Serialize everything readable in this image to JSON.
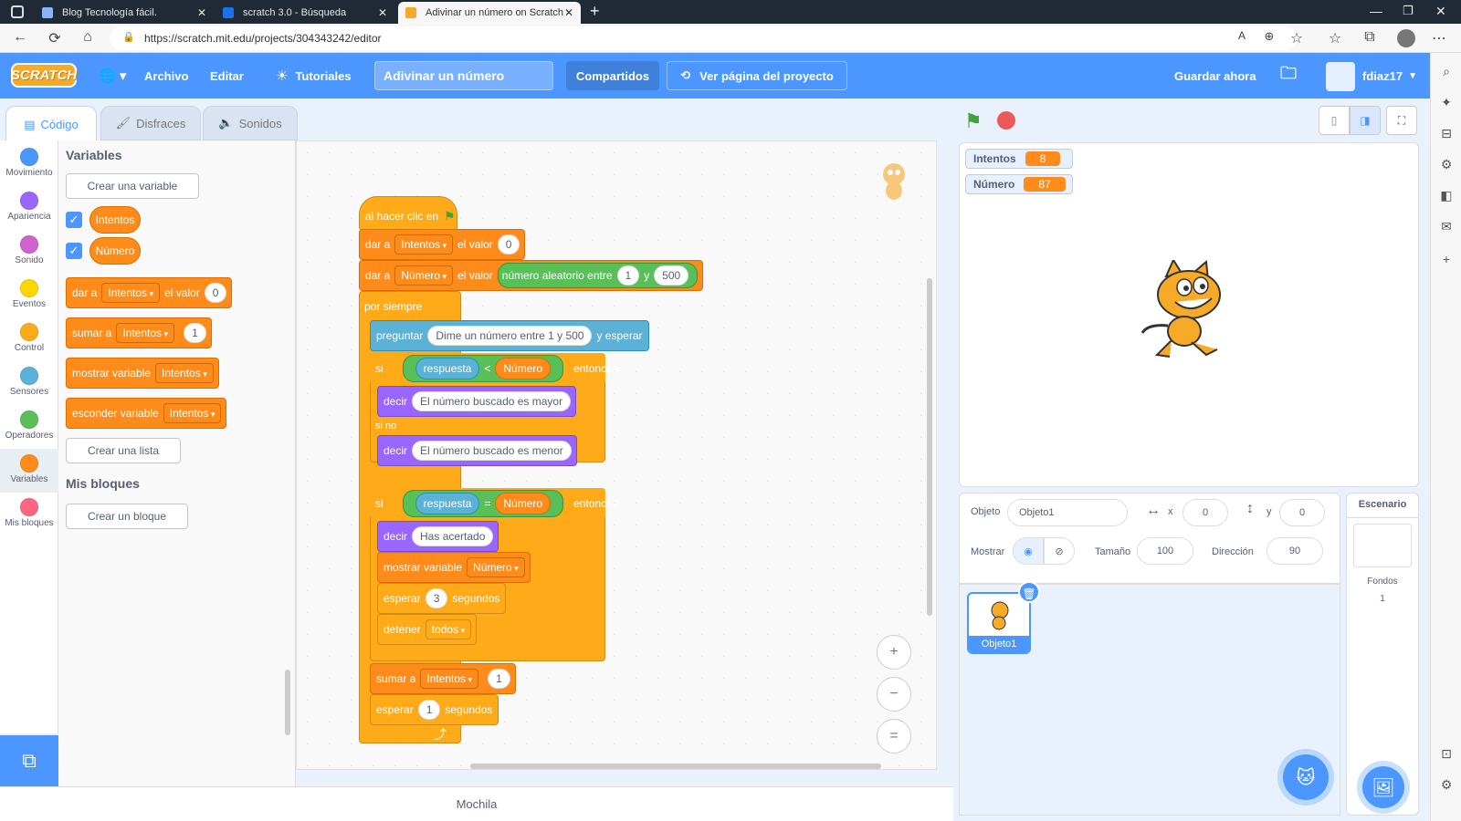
{
  "browser": {
    "tabs": [
      {
        "title": "Blog Tecnología fácil.",
        "favicon_color": "#8ab4f8"
      },
      {
        "title": "scratch 3.0 - Búsqueda",
        "favicon_color": "#1a73e8"
      },
      {
        "title": "Adivinar un número on Scratch",
        "favicon_color": "#f7a928"
      }
    ],
    "new_tab": "+",
    "url": "https://scratch.mit.edu/projects/304343242/editor"
  },
  "menu": {
    "logo": "SCRATCH",
    "globe": "🌐 ▾",
    "file": "Archivo",
    "edit": "Editar",
    "tutorials": "Tutoriales",
    "project_title": "Adivinar un número",
    "share": "Compartidos",
    "see_project": "Ver página del proyecto",
    "save_now": "Guardar ahora",
    "username": "fdiaz17"
  },
  "editor_tabs": {
    "code": "Código",
    "costumes": "Disfraces",
    "sounds": "Sonidos"
  },
  "categories": [
    {
      "label": "Movimiento",
      "color": "#4c97ff"
    },
    {
      "label": "Apariencia",
      "color": "#9966ff"
    },
    {
      "label": "Sonido",
      "color": "#cf63cf"
    },
    {
      "label": "Eventos",
      "color": "#ffd500"
    },
    {
      "label": "Control",
      "color": "#ffab19"
    },
    {
      "label": "Sensores",
      "color": "#5cb1d6"
    },
    {
      "label": "Operadores",
      "color": "#59c059"
    },
    {
      "label": "Variables",
      "color": "#ff8c1a"
    },
    {
      "label": "Mis bloques",
      "color": "#ff6680"
    }
  ],
  "palette": {
    "variables_heading": "Variables",
    "create_variable": "Crear una variable",
    "var1": "Intentos",
    "var2": "Número",
    "set_label": "dar a",
    "set_var": "Intentos",
    "set_value_label": "el valor",
    "set_value": "0",
    "change_label": "sumar a",
    "change_var": "Intentos",
    "change_value": "1",
    "show_label": "mostrar variable",
    "show_var": "Intentos",
    "hide_label": "esconder variable",
    "hide_var": "Intentos",
    "create_list": "Crear una lista",
    "myblocks_heading": "Mis bloques",
    "create_block": "Crear un bloque"
  },
  "script": {
    "hat": "al hacer clic en",
    "set1_label": "dar a",
    "set1_var": "Intentos",
    "set1_value_label": "el valor",
    "set1_value": "0",
    "set2_label": "dar a",
    "set2_var": "Número",
    "set2_value_label": "el valor",
    "random_label": "número aleatorio entre",
    "random_from": "1",
    "random_and": "y",
    "random_to": "500",
    "forever": "por siempre",
    "ask_label": "preguntar",
    "ask_text": "Dime un número entre 1 y 500",
    "ask_wait": "y esperar",
    "if1_label": "si",
    "answer1": "respuesta",
    "lt": "<",
    "num1": "Número",
    "then1": "entonces",
    "say1_label": "decir",
    "say1_text": "El número buscado es mayor",
    "else_label": "si no",
    "say2_label": "decir",
    "say2_text": "El número buscado es menor",
    "if2_label": "si",
    "answer2": "respuesta",
    "eq": "=",
    "num2": "Número",
    "then2": "entonces",
    "say3_label": "decir",
    "say3_text": "Has acertado",
    "show_label": "mostrar variable",
    "show_var": "Número",
    "wait1_label": "esperar",
    "wait1_value": "3",
    "wait1_unit": "segundos",
    "stop_label": "detener",
    "stop_value": "todos",
    "change_label": "sumar a",
    "change_var": "Intentos",
    "change_value": "1",
    "wait2_label": "esperar",
    "wait2_value": "1",
    "wait2_unit": "segundos",
    "loop_arrow": "⤴"
  },
  "zoom": {
    "in": "+",
    "out": "−",
    "reset": "="
  },
  "backpack": "Mochila",
  "stage": {
    "monitor1_label": "Intentos",
    "monitor1_value": "8",
    "monitor2_label": "Número",
    "monitor2_value": "87"
  },
  "sprite_info": {
    "sprite_label": "Objeto",
    "sprite_name": "Objeto1",
    "x_label": "x",
    "x_value": "0",
    "y_label": "y",
    "y_value": "0",
    "show_label": "Mostrar",
    "size_label": "Tamaño",
    "size_value": "100",
    "direction_label": "Dirección",
    "direction_value": "90"
  },
  "sprite_list": {
    "sprite_name": "Objeto1"
  },
  "stage_panel": {
    "title": "Escenario",
    "backdrops_label": "Fondos",
    "backdrops_count": "1"
  }
}
